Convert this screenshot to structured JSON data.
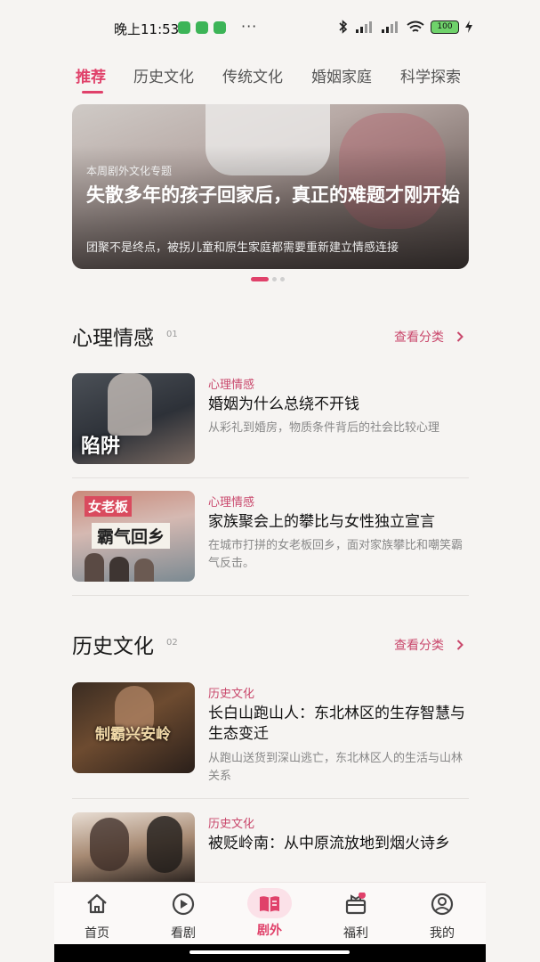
{
  "status": {
    "time": "晚上11:53",
    "dots": "···",
    "battery": "100"
  },
  "tabs": [
    {
      "label": "推荐",
      "active": true
    },
    {
      "label": "历史文化",
      "active": false
    },
    {
      "label": "传统文化",
      "active": false
    },
    {
      "label": "婚姻家庭",
      "active": false
    },
    {
      "label": "科学探索",
      "active": false
    }
  ],
  "banner": {
    "kicker": "本周剧外文化专题",
    "title": "失散多年的孩子回家后，真正的难题才刚开始",
    "subtitle": "团聚不是终点，被拐儿童和原生家庭都需要重新建立情感连接",
    "page_count": 3,
    "active_page": 1
  },
  "sections": [
    {
      "title": "心理情感",
      "num": "01",
      "more": "查看分类",
      "cards": [
        {
          "category": "心理情感",
          "title": "婚姻为什么总绕不开钱",
          "desc": "从彩礼到婚房，物质条件背后的社会比较心理",
          "thumb_text": "陷阱"
        },
        {
          "category": "心理情感",
          "title": "家族聚会上的攀比与女性独立宣言",
          "desc": "在城市打拼的女老板回乡，面对家族攀比和嘲笑霸气反击。",
          "thumb_text": "霸气回乡",
          "thumb_text2": "女老板"
        }
      ]
    },
    {
      "title": "历史文化",
      "num": "02",
      "more": "查看分类",
      "cards": [
        {
          "category": "历史文化",
          "title": "长白山跑山人：东北林区的生存智慧与生态变迁",
          "desc": "从跑山送货到深山逃亡，东北林区人的生活与山林关系",
          "thumb_text": "制霸兴安岭"
        },
        {
          "category": "历史文化",
          "title": "被贬岭南：从中原流放地到烟火诗乡",
          "desc": ""
        }
      ]
    }
  ],
  "nav": [
    {
      "label": "首页",
      "icon": "home-icon",
      "active": false
    },
    {
      "label": "看剧",
      "icon": "play-icon",
      "active": false
    },
    {
      "label": "剧外",
      "icon": "book-icon",
      "active": true
    },
    {
      "label": "福利",
      "icon": "gift-icon",
      "active": false
    },
    {
      "label": "我的",
      "icon": "profile-icon",
      "active": false
    }
  ],
  "colors": {
    "accent": "#e0416a",
    "category": "#c9486c",
    "background": "#f6f4f2"
  }
}
